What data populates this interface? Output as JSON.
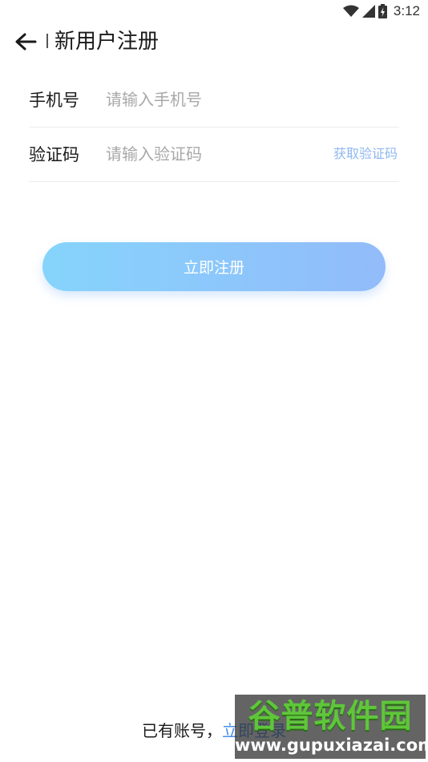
{
  "status_bar": {
    "time": "3:12",
    "icons": [
      "wifi-icon",
      "signal-icon",
      "battery-icon"
    ]
  },
  "header": {
    "title": "新用户注册",
    "back_icon": "arrow-left-icon"
  },
  "form": {
    "phone": {
      "label": "手机号",
      "value": "",
      "placeholder": "请输入手机号"
    },
    "code": {
      "label": "验证码",
      "value": "",
      "placeholder": "请输入验证码",
      "get_code_label": "获取验证码"
    }
  },
  "register_button": {
    "label": "立即注册"
  },
  "footer": {
    "prompt": "已有账号，",
    "login_link": "立即登录"
  },
  "watermark": {
    "brand": "谷普软件园",
    "url": "www.gupuxiazai.com"
  },
  "colors": {
    "accent_link": "#4a8fe8",
    "get_code": "#8fb8f0",
    "button_gradient_start": "#86d4fc",
    "button_gradient_end": "#92bbfa",
    "divider": "#ececec",
    "placeholder": "#a8a8a8"
  }
}
